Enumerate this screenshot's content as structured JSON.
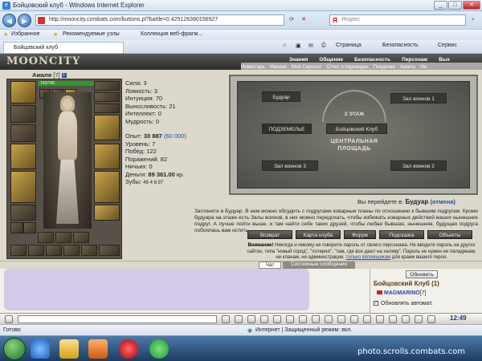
{
  "window": {
    "title": "Бойцовский клуб - Windows Internet Explorer",
    "url": "http://mooncity.combats.com/buttons.pl?battle=0.425128380156927",
    "search_placeholder": "Яндекс",
    "search_brand": "Я"
  },
  "favorites": {
    "favorites_label": "Избранное",
    "recommended": "Рекомендуемые узлы",
    "gallery": "Коллекция веб-фрагм..."
  },
  "tab": {
    "title": "Бойцовский клуб",
    "commands": [
      "Страница",
      "Безопасность",
      "Сервис"
    ]
  },
  "site": {
    "logo": "MOONCITY",
    "nav": [
      "Знания",
      "Общение",
      "Безопасность",
      "Персонаж",
      "Вых"
    ],
    "subnav": [
      "Инвентарь",
      "Умения",
      "Мой Скроллл",
      "Отчет о переводах",
      "Поединки",
      "Анкета",
      "На"
    ]
  },
  "character": {
    "name": "Амаля",
    "level": "[7]",
    "info_icon": "i",
    "hp": "743/743",
    "stats": [
      {
        "label": "Сила:",
        "value": "3"
      },
      {
        "label": "Ловкость:",
        "value": "3"
      },
      {
        "label": "Интуиция:",
        "value": "70"
      },
      {
        "label": "Выносливость:",
        "value": "21"
      },
      {
        "label": "Интеллект:",
        "value": "0"
      },
      {
        "label": "Мудрость:",
        "value": "0"
      }
    ],
    "exp_label": "Опыт:",
    "exp_value": "30 887",
    "exp_next": "(60 000)",
    "level_label": "Уровень:",
    "level_value": "7",
    "wins_label": "Побед:",
    "wins_value": "122",
    "losses_label": "Поражений:",
    "losses_value": "82",
    "draws_label": "Ничьих:",
    "draws_value": "0",
    "money_label": "Деньги:",
    "money_value": "89 361.00",
    "money_unit": "кр.",
    "teeth_label": "Зубы:",
    "teeth_value": "46 4 8.97"
  },
  "map": {
    "rooms": [
      "Будуар",
      "Зал воинов 1",
      "2 ЭТАЖ",
      "ПОДЗЕМЕЛЬЕ",
      "Бойцовский Клуб",
      "Зал воинов 3",
      "Зал воинов 2"
    ],
    "center": "ЦЕНТРАЛЬНАЯ ПЛОЩАДЬ",
    "goto_prefix": "Вы перейдете в:",
    "goto_target": "Будуар",
    "cancel": "(отмена)"
  },
  "description": "Загляните в Будуар. В нем можно обсудить с подругами коварные планы по отношению к бывшим подругам. Кроме будуара на этаже есть Залы воинов, в них можно передохать, чтобы избежать коварных действий ваших нынешних подруг. А лучше пойти выше, и там найти себе таких друзей, чтобы любая бывшая, нынешняя, будущая подруга побоялась вам нстить.",
  "buttons": [
    "Возврат",
    "Карта клуба",
    "Форум",
    "Подсказка",
    "Объекты"
  ],
  "warning": {
    "bold": "Внимание!",
    "text": "Никогда и никому не говорите пароль от своего персонажа. Не вводите пароль на других сайтах, типа \"новый город\", \"лотерея\", \"там, где все дают на халяву\". Пароль не нужен ни паладинам, ни кланам, ни администрации,",
    "link": "только взломщикам",
    "tail": "для кражи вашего героя."
  },
  "chat": {
    "tab_chat": "Чат",
    "tab_system": "Системные сообщения"
  },
  "online": {
    "refresh": "Обновить",
    "club": "Бойцовский Клуб (1)",
    "user": "MAGMARINO",
    "user_level": "[7]",
    "auto_refresh": "Обновлять автомат."
  },
  "toolbar": {
    "clock": "12:49"
  },
  "status": {
    "ready": "Готово",
    "zone": "Интернет | Защищенный режим: вкл."
  },
  "watermark": "photo.scrolls.combats.com"
}
